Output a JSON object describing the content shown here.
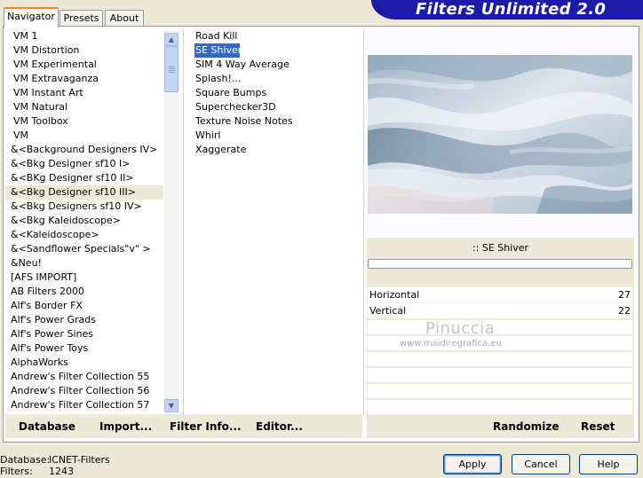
{
  "title": "Filters Unlimited 2.0",
  "tabs": [
    {
      "label": "Navigator"
    },
    {
      "label": "Presets"
    },
    {
      "label": "About"
    }
  ],
  "categories": [
    "VM 1",
    "VM Distortion",
    "VM Experimental",
    "VM Extravaganza",
    "VM Instant Art",
    "VM Natural",
    "VM Toolbox",
    "VM",
    "&<Background Designers IV>",
    "&<Bkg Designer sf10 I>",
    "&<BKg Designer sf10 II>",
    "&<Bkg Designer sf10 III>",
    "&<Bkg Designers sf10 IV>",
    "&<Bkg Kaleidoscope>",
    "&<Kaleidoscope>",
    "&<Sandflower Specials\"v\" >",
    "&Neu!",
    "[AFS IMPORT]",
    "AB Filters 2000",
    "Alf's Border FX",
    "Alf's Power Grads",
    "Alf's Power Sines",
    "Alf's Power Toys",
    "AlphaWorks",
    "Andrew's Filter Collection 55",
    "Andrew's Filter Collection 56",
    "Andrew's Filter Collection 57"
  ],
  "selected_category": "&<Bkg Designer sf10 III>",
  "filters": [
    "Road Kill",
    "SE Shiver",
    "SIM 4 Way Average",
    "Splash!...",
    "Square Bumps",
    "Superchecker3D",
    "Texture Noise Notes",
    "Whirl",
    "Xaggerate"
  ],
  "selected_filter": "SE Shiver",
  "filter_display_name": ":: SE Shiver",
  "params": [
    {
      "label": "Horizontal",
      "value": "27"
    },
    {
      "label": "Vertical",
      "value": "22"
    }
  ],
  "watermark": {
    "name": "Pinuccia",
    "url": "www.maidiregrafica.eu"
  },
  "toolbar": {
    "database": "Database",
    "import": "Import...",
    "filter_info": "Filter Info...",
    "editor": "Editor...",
    "randomize": "Randomize",
    "reset": "Reset"
  },
  "status": {
    "database_label": "Database:",
    "database_value": "ICNET-Filters",
    "filters_label": "Filters:",
    "filters_value": "1243"
  },
  "buttons": {
    "apply": "Apply",
    "cancel": "Cancel",
    "help": "Help"
  },
  "icons": {
    "scroll_up": "chevron-up-icon",
    "scroll_down": "chevron-down-icon"
  },
  "colors": {
    "title_banner": "#1e1aa8",
    "selection": "#316ac5",
    "active_tab_accent": "#e68b2c"
  }
}
